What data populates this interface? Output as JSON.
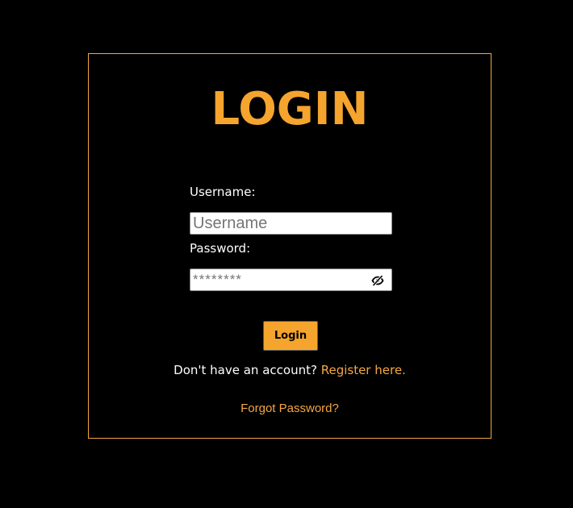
{
  "form": {
    "title": "LOGIN",
    "username_label": "Username:",
    "username_placeholder": "Username",
    "password_label": "Password:",
    "password_placeholder": "********",
    "password_toggle_icon": "eye-slash-icon",
    "login_button": "Login",
    "register_prompt": "Don't have an account?",
    "register_link": "Register here.",
    "forgot_link": "Forgot Password?"
  },
  "colors": {
    "background": "#000000",
    "accent": "#f5a42e",
    "border": "#f5a742",
    "text": "#ffffff"
  }
}
